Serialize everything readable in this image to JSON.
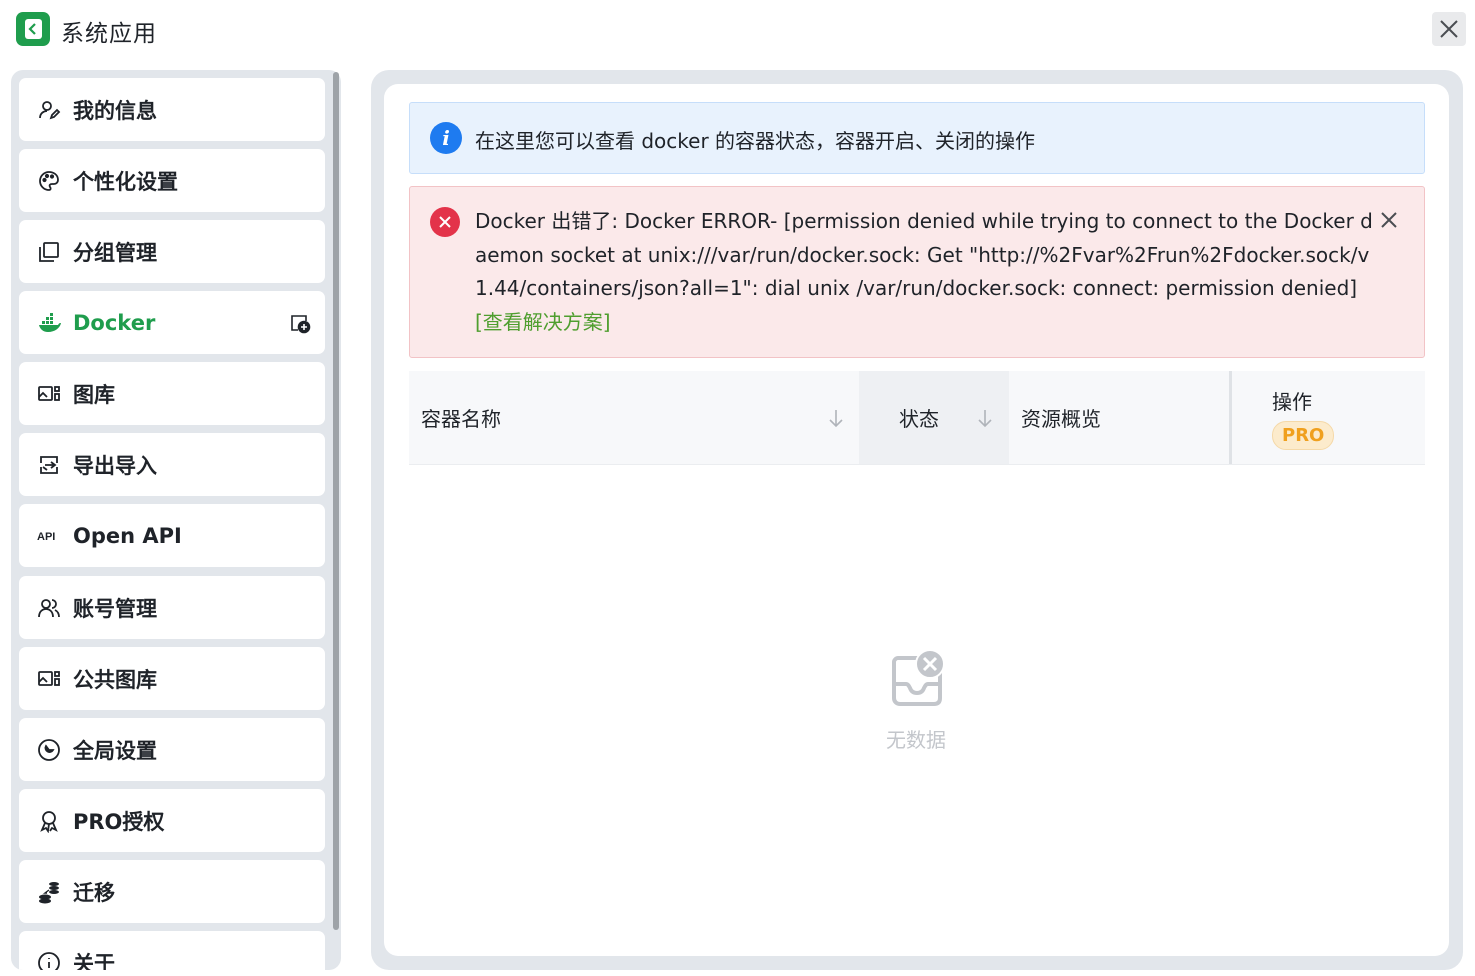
{
  "window": {
    "title": "系统应用",
    "close_icon": "close-icon"
  },
  "sidebar": {
    "items": [
      {
        "label": "我的信息",
        "icon": "user-edit-icon"
      },
      {
        "label": "个性化设置",
        "icon": "palette-icon"
      },
      {
        "label": "分组管理",
        "icon": "layers-icon"
      },
      {
        "label": "Docker",
        "icon": "docker-icon",
        "active": true,
        "extra_icon": "add-container-icon"
      },
      {
        "label": "图库",
        "icon": "gallery-icon"
      },
      {
        "label": "导出导入",
        "icon": "export-import-icon"
      },
      {
        "label": "Open API",
        "icon": "api-icon"
      },
      {
        "label": "账号管理",
        "icon": "users-icon"
      },
      {
        "label": "公共图库",
        "icon": "gallery-icon"
      },
      {
        "label": "全局设置",
        "icon": "global-settings-icon"
      },
      {
        "label": "PRO授权",
        "icon": "award-icon"
      },
      {
        "label": "迁移",
        "icon": "migrate-icon"
      },
      {
        "label": "关于",
        "icon": "info-icon"
      }
    ]
  },
  "info_alert": {
    "text": "在这里您可以查看 docker 的容器状态，容器开启、关闭的操作",
    "icon": "info-icon"
  },
  "error_alert": {
    "text": "Docker 出错了: Docker ERROR- [permission denied while trying to connect to the Docker daemon socket at unix:///var/run/docker.sock: Get \"http://%2Fvar%2Frun%2Fdocker.sock/v1.44/containers/json?all=1\": dial unix /var/run/docker.sock: connect: permission denied]",
    "link": "[查看解决方案]",
    "icon": "error-icon"
  },
  "table": {
    "columns": {
      "name": "容器名称",
      "state": "状态",
      "resources": "资源概览",
      "actions": "操作"
    },
    "actions_badge": "PRO",
    "rows": []
  },
  "empty": {
    "text": "无数据"
  },
  "colors": {
    "accent": "#1f9d4d",
    "info": "#1e7bf0",
    "error": "#e3334a",
    "link": "#4f9e2f",
    "pro": "#f0a01e"
  }
}
